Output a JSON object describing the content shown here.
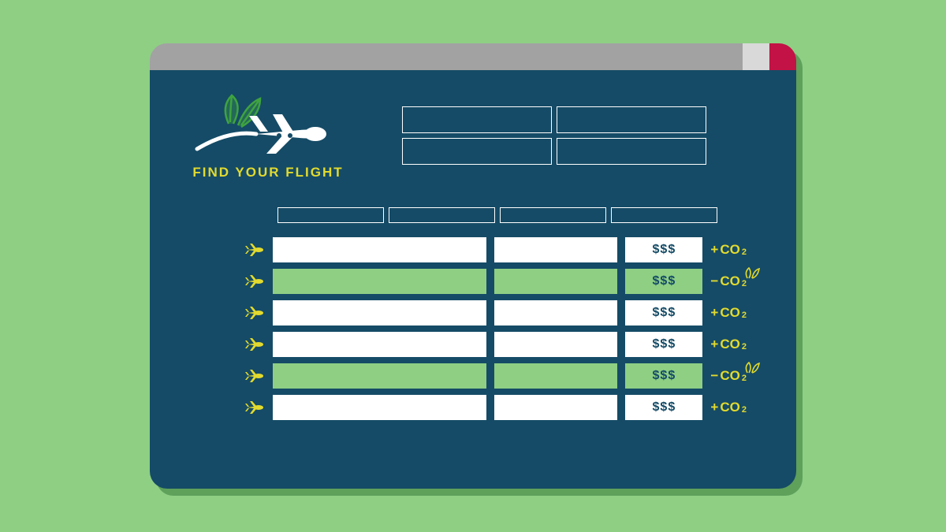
{
  "colors": {
    "page_bg": "#8ecf84",
    "window_bg": "#154b66",
    "titlebar_gray": "#a2a2a2",
    "titlebar_light": "#d9d9d9",
    "titlebar_red": "#c31245",
    "accent_yellow": "#e2da2e",
    "row_white": "#ffffff",
    "row_green": "#8ecf84"
  },
  "header": {
    "tagline": "FIND YOUR FLIGHT",
    "logo_icon": "airplane-with-leaves",
    "search_fields": [
      {
        "id": "from",
        "value": ""
      },
      {
        "id": "to",
        "value": ""
      },
      {
        "id": "depart",
        "value": ""
      },
      {
        "id": "return",
        "value": ""
      }
    ]
  },
  "table": {
    "columns": [
      "",
      "",
      "",
      ""
    ],
    "rows": [
      {
        "icon": "plane-icon",
        "price": "$$$",
        "co2_sign": "+",
        "co2_label": "CO",
        "co2_sub": "2",
        "eco": false
      },
      {
        "icon": "plane-icon",
        "price": "$$$",
        "co2_sign": "−",
        "co2_label": "CO",
        "co2_sub": "2",
        "eco": true
      },
      {
        "icon": "plane-icon",
        "price": "$$$",
        "co2_sign": "+",
        "co2_label": "CO",
        "co2_sub": "2",
        "eco": false
      },
      {
        "icon": "plane-icon",
        "price": "$$$",
        "co2_sign": "+",
        "co2_label": "CO",
        "co2_sub": "2",
        "eco": false
      },
      {
        "icon": "plane-icon",
        "price": "$$$",
        "co2_sign": "−",
        "co2_label": "CO",
        "co2_sub": "2",
        "eco": true
      },
      {
        "icon": "plane-icon",
        "price": "$$$",
        "co2_sign": "+",
        "co2_label": "CO",
        "co2_sub": "2",
        "eco": false
      }
    ]
  }
}
